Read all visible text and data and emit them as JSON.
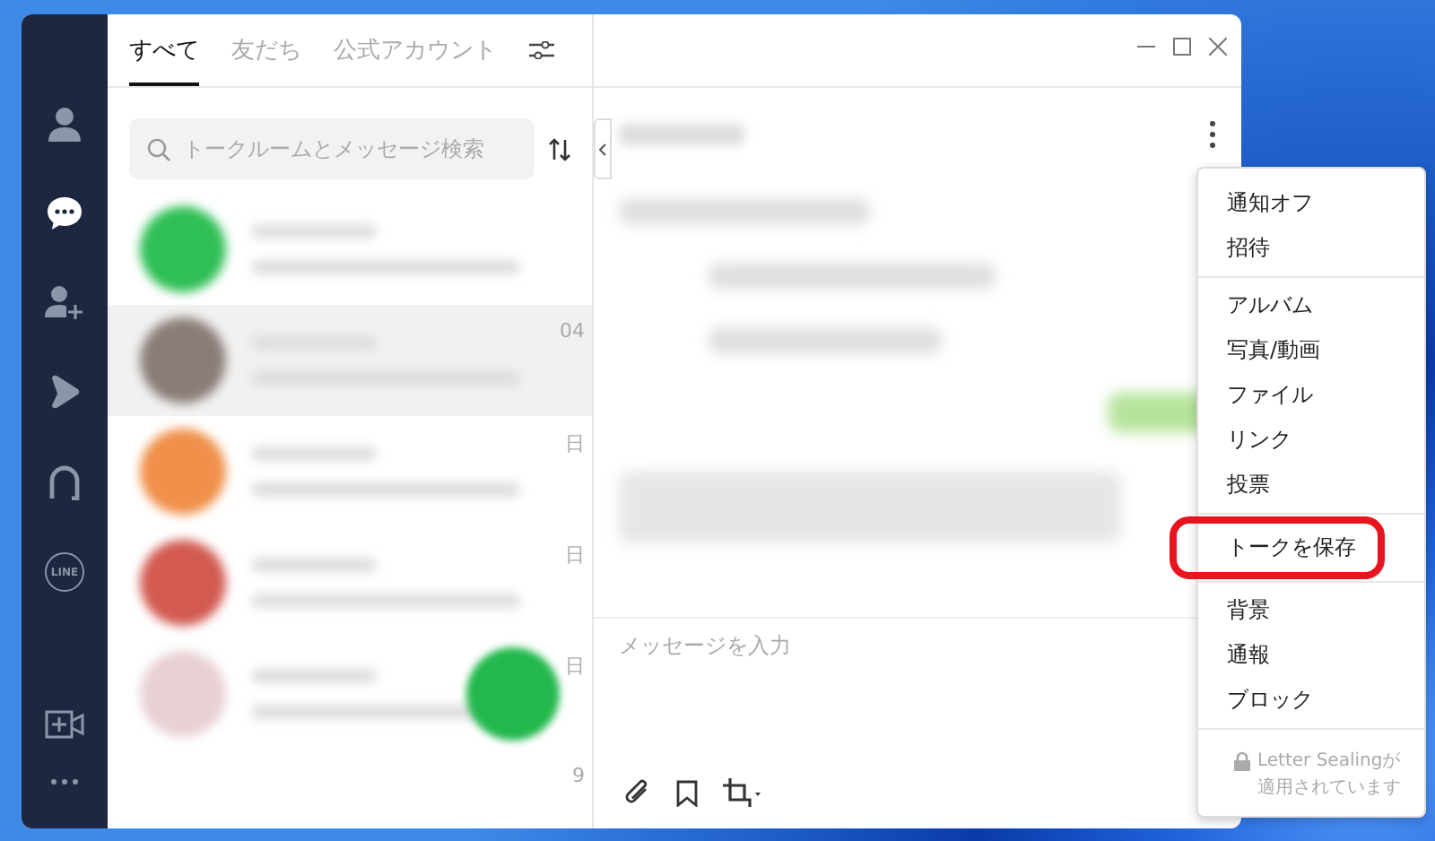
{
  "sidebar": {
    "items": [
      {
        "kind": "profile",
        "selected": false
      },
      {
        "kind": "chats",
        "selected": true
      },
      {
        "kind": "add-friend",
        "selected": false
      },
      {
        "kind": "play",
        "selected": false
      },
      {
        "kind": "arc",
        "selected": false
      },
      {
        "kind": "line",
        "label": "LINE",
        "selected": false
      }
    ],
    "bottom": [
      {
        "kind": "video-add"
      },
      {
        "kind": "more"
      }
    ]
  },
  "tabs": [
    {
      "label": "すべて",
      "selected": true
    },
    {
      "label": "友だち",
      "selected": false
    },
    {
      "label": "公式アカウント",
      "selected": false
    }
  ],
  "search": {
    "placeholder": "トークルームとメッセージ検索"
  },
  "chat_list": [
    {
      "color": "#2fbf55",
      "selected": false
    },
    {
      "color": "#8a7d78",
      "selected": true,
      "date": "04"
    },
    {
      "color": "#f0904a",
      "selected": false,
      "date": "日"
    },
    {
      "color": "#d25a50",
      "selected": false,
      "date": "日"
    },
    {
      "color": "#e8d0d4",
      "selected": false,
      "date": "日"
    },
    {
      "selected": false,
      "date": "9"
    }
  ],
  "chat": {
    "input": {
      "placeholder": "メッセージを入力"
    }
  },
  "menu": {
    "groups": [
      [
        {
          "label": "通知オフ",
          "highlighted": false
        },
        {
          "label": "招待",
          "highlighted": false
        }
      ],
      [
        {
          "label": "アルバム",
          "highlighted": false
        },
        {
          "label": "写真/動画",
          "highlighted": false
        },
        {
          "label": "ファイル",
          "highlighted": false
        },
        {
          "label": "リンク",
          "highlighted": false
        },
        {
          "label": "投票",
          "highlighted": false
        }
      ],
      [
        {
          "label": "トークを保存",
          "highlighted": true
        }
      ],
      [
        {
          "label": "背景",
          "highlighted": false
        },
        {
          "label": "通報",
          "highlighted": false
        },
        {
          "label": "ブロック",
          "highlighted": false
        }
      ]
    ],
    "footer": [
      "Letter Sealingが",
      "適用されています"
    ]
  }
}
